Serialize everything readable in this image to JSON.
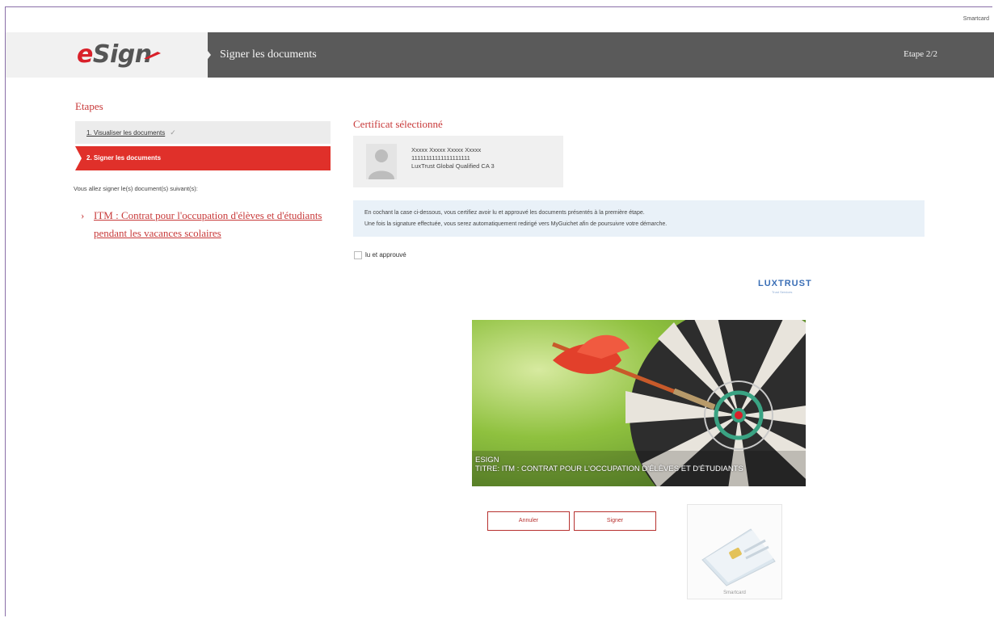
{
  "top_bar": {
    "user_label": "Smartcard"
  },
  "header": {
    "logo_e": "e",
    "logo_rest": "Sign",
    "title": "Signer les documents",
    "step": "Etape 2/2"
  },
  "sidebar": {
    "title": "Etapes",
    "steps": [
      {
        "label": "1. Visualiser les documents",
        "state": "done"
      },
      {
        "label": "2. Signer les documents",
        "state": "active"
      }
    ],
    "intro": "Vous allez signer le(s) document(s) suivant(s):",
    "documents": [
      {
        "label": "ITM : Contrat pour l'occupation d'élèves et d'étudiants pendant les vacances scolaires"
      }
    ]
  },
  "certificate": {
    "title": "Certificat sélectionné",
    "lines": [
      "Xxxxx Xxxxx Xxxxx Xxxxx",
      "11111111111111111111",
      "LuxTrust Global Qualified CA 3"
    ]
  },
  "info": {
    "line1": "En cochant la case ci-dessous, vous certifiez avoir lu et approuvé les documents présentés à la première étape.",
    "line2": "Une fois la signature effectuée, vous serez automatiquement redirigé vers MyGuichet afin de poursuivre votre démarche."
  },
  "agree": {
    "label": "lu et approuvé"
  },
  "brand": {
    "name": "LUXTRUST",
    "tagline": "Trust Services"
  },
  "preview": {
    "caption_line1": "ESIGN",
    "caption_line2": "TITRE: ITM : CONTRAT POUR L'OCCUPATION D'ÉLÈVES ET D'ÉTUDIANTS"
  },
  "actions": {
    "cancel_label": "Annuler",
    "sign_label": "Signer",
    "card_label": "Smartcard"
  },
  "colors": {
    "accent": "#e0302a",
    "header_bg": "#5a5a5a",
    "info_bg": "#e9f1f8"
  }
}
